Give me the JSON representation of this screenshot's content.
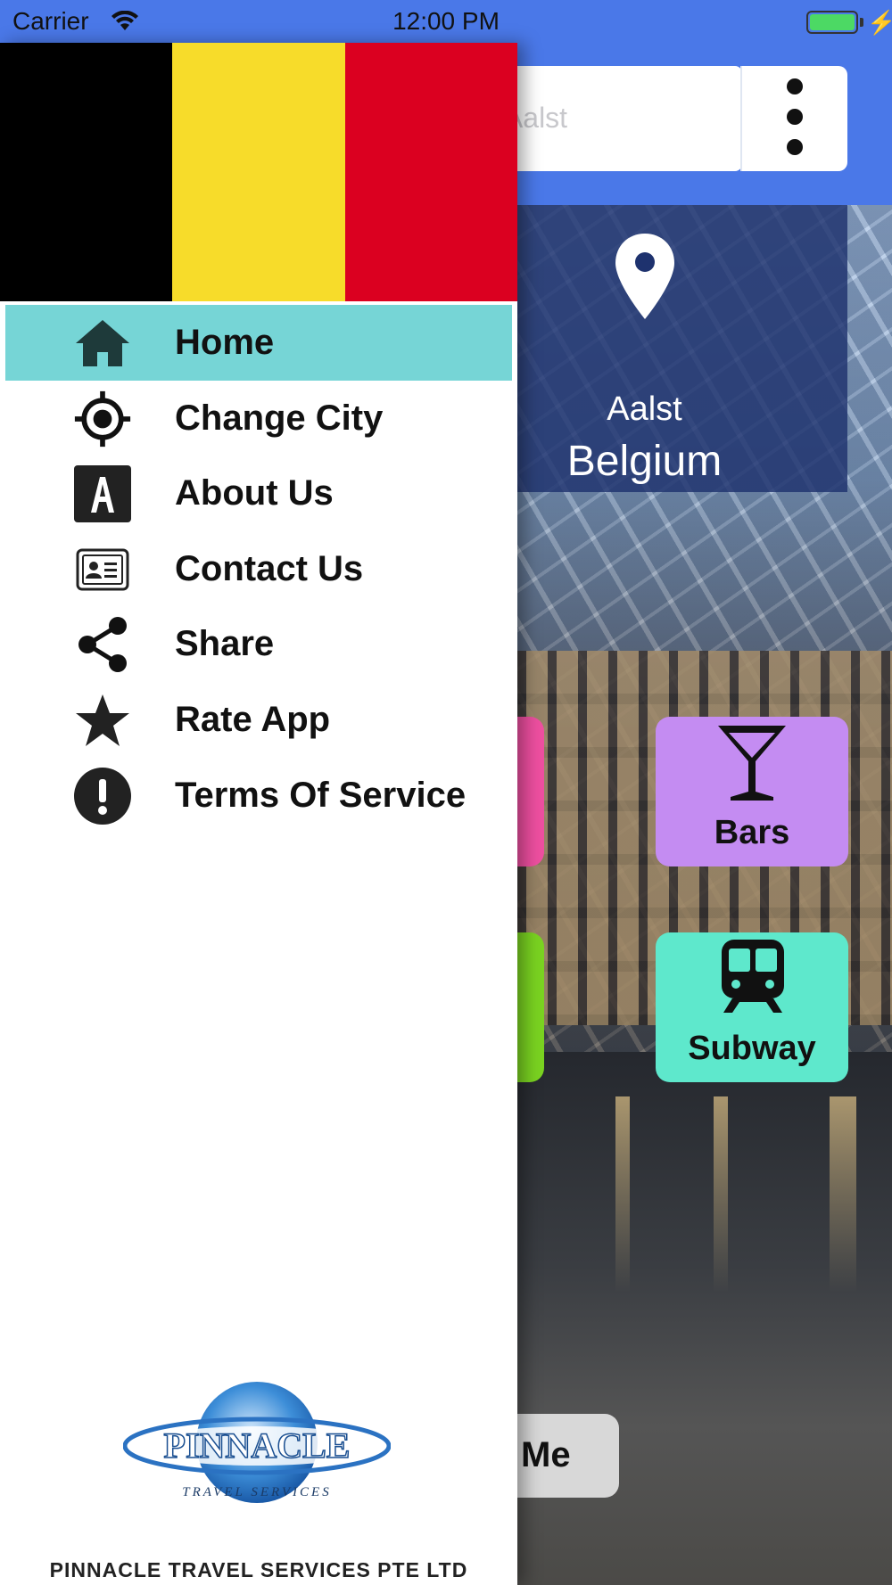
{
  "status_bar": {
    "carrier": "Carrier",
    "time": "12:00 PM"
  },
  "background": {
    "search_placeholder": "n Aalst",
    "city": "Aalst",
    "country": "Belgium",
    "tiles": [
      {
        "label": "Bars",
        "icon": "cocktail-icon",
        "color": "#c48cf2"
      },
      {
        "label": "Subway",
        "icon": "train-icon",
        "color": "#5ee8cc"
      }
    ],
    "me_button_label": "Me"
  },
  "drawer": {
    "flag_colors": [
      "#000000",
      "#f7dc2a",
      "#db0020"
    ],
    "items": [
      {
        "label": "Home",
        "icon": "home-icon",
        "active": true
      },
      {
        "label": "Change City",
        "icon": "target-icon"
      },
      {
        "label": "About Us",
        "icon": "letter-a-icon"
      },
      {
        "label": "Contact Us",
        "icon": "contact-card-icon"
      },
      {
        "label": "Share",
        "icon": "share-icon"
      },
      {
        "label": "Rate App",
        "icon": "star-icon"
      },
      {
        "label": "Terms Of Service",
        "icon": "exclamation-icon"
      }
    ],
    "logo_text": "PINNACLE",
    "logo_subtext": "TRAVEL SERVICES",
    "company_name": "PINNACLE TRAVEL SERVICES PTE LTD",
    "active_color": "#76d5d6"
  }
}
